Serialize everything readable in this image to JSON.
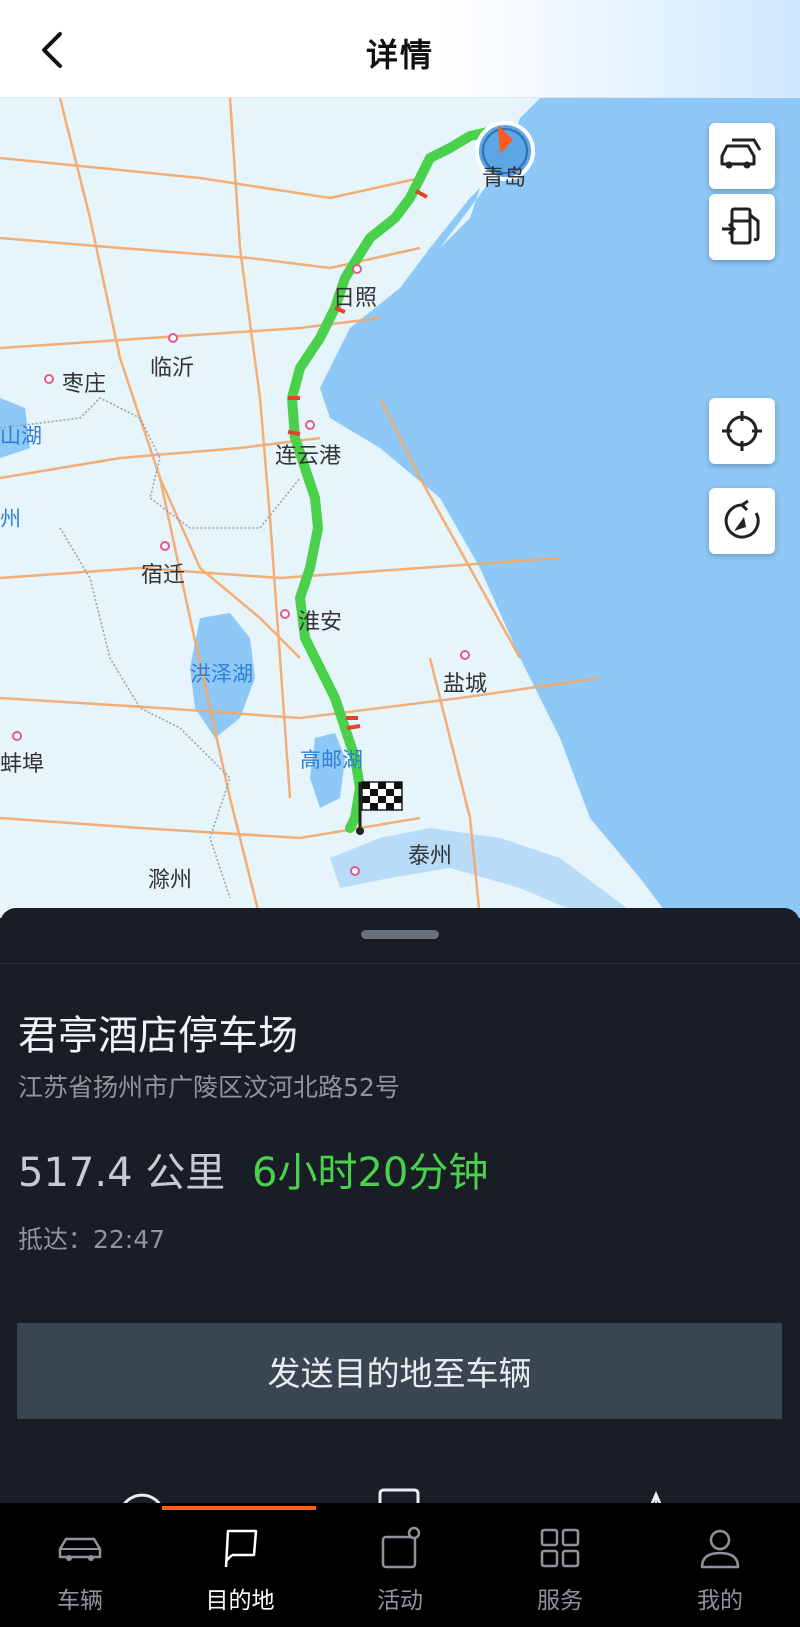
{
  "header": {
    "title": "详情"
  },
  "map": {
    "cities": [
      "青岛",
      "日照",
      "枣庄",
      "临沂",
      "连云港",
      "宿迁",
      "淮安",
      "盐城",
      "泰州",
      "滁州",
      "蚌埠"
    ],
    "lakes": [
      "洪泽湖",
      "高邮湖",
      "山湖",
      "州"
    ],
    "controls": [
      "traffic-car-icon",
      "gas-station-icon",
      "locate-icon",
      "compass-icon"
    ]
  },
  "destination": {
    "name": "君亭酒店停车场",
    "address": "江苏省扬州市广陵区汶河北路52号",
    "distance": "517.4 公里",
    "duration": "6小时20分钟",
    "arrival": "抵达：22:47"
  },
  "actions": {
    "send_label": "发送目的地至车辆"
  },
  "tabs": [
    {
      "label": "车辆",
      "icon": "car-icon",
      "active": false
    },
    {
      "label": "目的地",
      "icon": "flag-icon",
      "active": true
    },
    {
      "label": "活动",
      "icon": "activity-icon",
      "active": false
    },
    {
      "label": "服务",
      "icon": "grid-icon",
      "active": false
    },
    {
      "label": "我的",
      "icon": "user-icon",
      "active": false
    }
  ],
  "colors": {
    "accent": "#ff5b1f",
    "route": "#4bd04b",
    "sea": "#8ec8f6",
    "land": "#e6f4fb",
    "road": "#f4a766"
  }
}
